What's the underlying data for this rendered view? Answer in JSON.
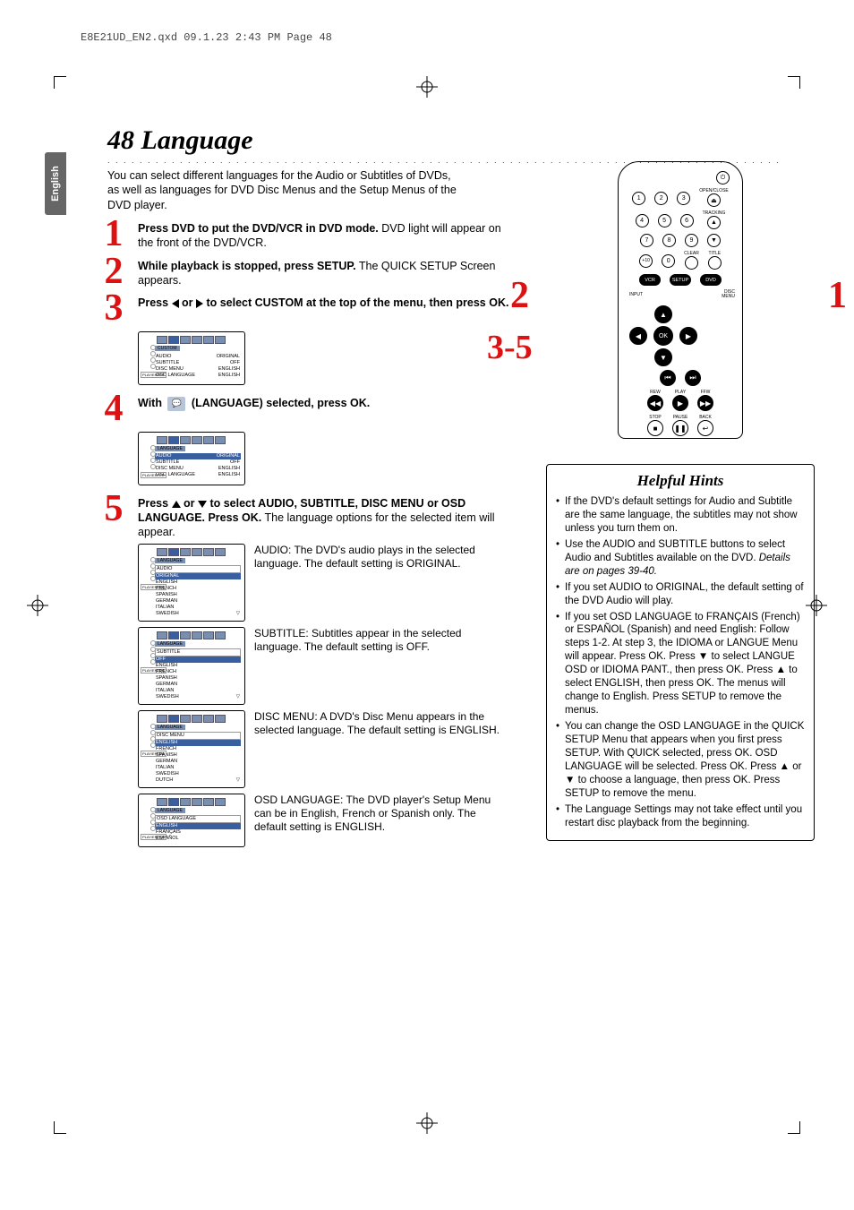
{
  "slug": "E8E21UD_EN2.qxd  09.1.23  2:43 PM  Page 48",
  "side_tab": "English",
  "page_title": "48  Language",
  "intro": "You can select different languages for the Audio or Subtitles of DVDs, as well as languages for DVD Disc Menus and the Setup Menus of the DVD player.",
  "steps": {
    "s1_bold": "Press DVD to put the DVD/VCR in DVD mode.",
    "s1_rest": " DVD light will appear on the front of the DVD/VCR.",
    "s2_bold": "While playback is stopped, press SETUP.",
    "s2_rest": " The QUICK SETUP Screen appears.",
    "s3_bold_a": "Press ",
    "s3_bold_b": " or ",
    "s3_bold_c": " to select CUSTOM at the top of the menu, then press OK.",
    "s4_a": "With ",
    "s4_b": " (LANGUAGE) selected, press OK.",
    "s5_bold_a": "Press ",
    "s5_bold_b": " or ",
    "s5_bold_c": " to select AUDIO, SUBTITLE, DISC MENU or OSD LANGUAGE. Press OK.",
    "s5_rest": " The language options for the selected item will appear."
  },
  "osd_custom": {
    "crumb": "CUSTOM",
    "items": [
      {
        "l": "AUDIO",
        "r": "ORIGINAL"
      },
      {
        "l": "SUBTITLE",
        "r": "OFF"
      },
      {
        "l": "DISC MENU",
        "r": "ENGLISH"
      },
      {
        "l": "OSD LANGUAGE",
        "r": "ENGLISH"
      }
    ]
  },
  "osd_lang": {
    "crumb": "LANGUAGE",
    "items": [
      {
        "l": "AUDIO",
        "r": "ORIGINAL",
        "hi": true
      },
      {
        "l": "SUBTITLE",
        "r": "OFF"
      },
      {
        "l": "DISC MENU",
        "r": "ENGLISH"
      },
      {
        "l": "OSD LANGUAGE",
        "r": "ENGLISH"
      }
    ]
  },
  "osd_audio": {
    "crumb": "LANGUAGE",
    "header": "AUDIO",
    "items": [
      "ORIGINAL",
      "ENGLISH",
      "FRENCH",
      "SPANISH",
      "GERMAN",
      "ITALIAN",
      "SWEDISH"
    ]
  },
  "osd_subtitle": {
    "crumb": "LANGUAGE",
    "header": "SUBTITLE",
    "items": [
      "OFF",
      "ENGLISH",
      "FRENCH",
      "SPANISH",
      "GERMAN",
      "ITALIAN",
      "SWEDISH"
    ]
  },
  "osd_discmenu": {
    "crumb": "LANGUAGE",
    "header": "DISC MENU",
    "items": [
      "ENGLISH",
      "FRENCH",
      "SPANISH",
      "GERMAN",
      "ITALIAN",
      "SWEDISH",
      "DUTCH"
    ]
  },
  "osd_osdlang": {
    "crumb": "LANGUAGE",
    "header": "OSD LANGUAGE",
    "items": [
      "ENGLISH",
      "FRANÇAIS",
      "ESPAÑOL"
    ]
  },
  "sub_play_enter": "PLAY/ENTER",
  "substeps": {
    "audio": "AUDIO:  The DVD's audio plays in the selected language.\nThe default setting is ORIGINAL.",
    "subtitle": "SUBTITLE:  Subtitles appear in the selected language.\nThe default setting is OFF.",
    "discmenu": "DISC MENU:  A DVD's Disc Menu appears in the selected language.\nThe default setting is ENGLISH.",
    "osdlang": "OSD LANGUAGE:  The DVD player's Setup Menu can be in English, French or Spanish only. The default setting is ENGLISH."
  },
  "remote": {
    "callouts": {
      "a": "2",
      "b": "1",
      "c": "3-5"
    },
    "labels": {
      "openclose": "OPEN/CLOSE",
      "tracking": "TRACKING",
      "clear": "CLEAR",
      "title": "TITLE",
      "vcr": "VCR",
      "setup": "SETUP",
      "dvd": "DVD",
      "input": "INPUT",
      "disc": "DISC",
      "menu": "MENU",
      "ok": "OK",
      "rew": "REW",
      "play": "PLAY",
      "ffw": "FFW",
      "stop": "STOP",
      "pause": "PAUSE",
      "back": "BACK",
      "plus10": "+10"
    },
    "nums": [
      "1",
      "2",
      "3",
      "4",
      "5",
      "6",
      "7",
      "8",
      "9",
      "0"
    ]
  },
  "hints": {
    "title": "Helpful Hints",
    "items": [
      "If the DVD's default settings for Audio and Subtitle are the same language, the subtitles may not show unless you turn them on.",
      "Use the AUDIO and SUBTITLE buttons to select Audio and Subtitles available on the DVD. <i>Details are on pages 39-40.</i>",
      "If you set AUDIO to ORIGINAL, the default setting of the DVD Audio will play.",
      "If you set OSD LANGUAGE to FRANÇAIS (French) or ESPAÑOL (Spanish) and need English: Follow steps 1-2. At step 3, the IDIOMA or LANGUE Menu will appear. Press OK. Press ▼ to select LANGUE OSD or IDIOMA PANT., then press OK. Press ▲ to select ENGLISH, then press OK. The menus will change to English. Press SETUP to remove the menus.",
      "You can change the OSD LANGUAGE in the QUICK SETUP Menu that appears when you first press SETUP. With QUICK selected, press OK. OSD LANGUAGE will be selected. Press OK. Press ▲ or ▼ to choose a language, then press OK. Press SETUP to remove the menu.",
      "The Language Settings may not take effect until you restart disc playback from the beginning."
    ]
  }
}
